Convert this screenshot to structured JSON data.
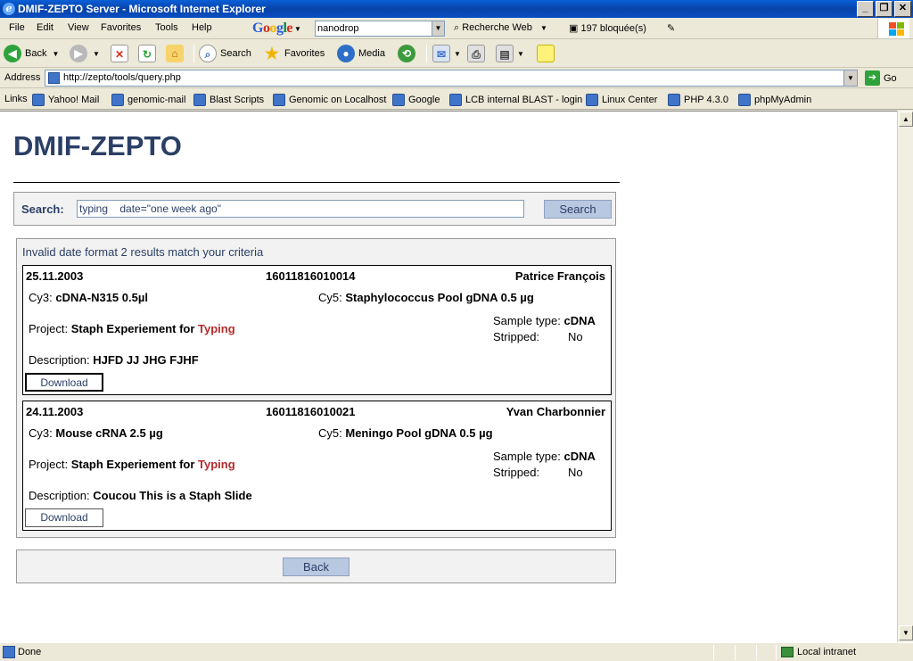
{
  "window": {
    "title": "DMIF-ZEPTO Server - Microsoft Internet Explorer"
  },
  "menu": [
    "File",
    "Edit",
    "View",
    "Favorites",
    "Tools",
    "Help"
  ],
  "google_toolbar": {
    "search_value": "nanodrop",
    "web_search_label": "Recherche Web",
    "blocked_label": "197 bloquée(s)"
  },
  "toolbar": {
    "back": "Back",
    "search": "Search",
    "favorites": "Favorites",
    "media": "Media"
  },
  "address": {
    "label": "Address",
    "url": "http://zepto/tools/query.php",
    "go": "Go"
  },
  "links": {
    "label": "Links",
    "items": [
      "Yahoo! Mail",
      "genomic-mail",
      "Blast Scripts",
      "Genomic on Localhost",
      "Google",
      "LCB internal BLAST - login",
      "Linux Center",
      "PHP 4.3.0",
      "phpMyAdmin"
    ]
  },
  "page": {
    "title": "DMIF-ZEPTO",
    "search_label": "Search:",
    "search_value": "typing    date=\"one week ago\"",
    "search_button": "Search",
    "results_message": "Invalid date format 2 results match your criteria",
    "back_button": "Back",
    "labels": {
      "cy3": "Cy3:",
      "cy5": "Cy5:",
      "project": "Project:",
      "sample_type": "Sample type:",
      "stripped": "Stripped:",
      "description": "Description:",
      "download": "Download"
    },
    "results": [
      {
        "date": "25.11.2003",
        "barcode": "16011816010014",
        "owner": "Patrice François",
        "cy3": "cDNA-N315 0.5µl",
        "cy5": "Staphylococcus Pool gDNA 0.5 µg",
        "project_prefix": "Staph Experiement for",
        "project_highlight": "Typing",
        "sample_type": "cDNA",
        "stripped": "No",
        "description": "HJFD JJ JHG FJHF"
      },
      {
        "date": "24.11.2003",
        "barcode": "16011816010021",
        "owner": "Yvan Charbonnier",
        "cy3": "Mouse cRNA 2.5 µg",
        "cy5": "Meningo Pool gDNA 0.5 µg",
        "project_prefix": "Staph Experiement for",
        "project_highlight": "Typing",
        "sample_type": "cDNA",
        "stripped": "No",
        "description": "Coucou This is a Staph Slide"
      }
    ]
  },
  "status": {
    "text": "Done",
    "zone": "Local intranet"
  }
}
